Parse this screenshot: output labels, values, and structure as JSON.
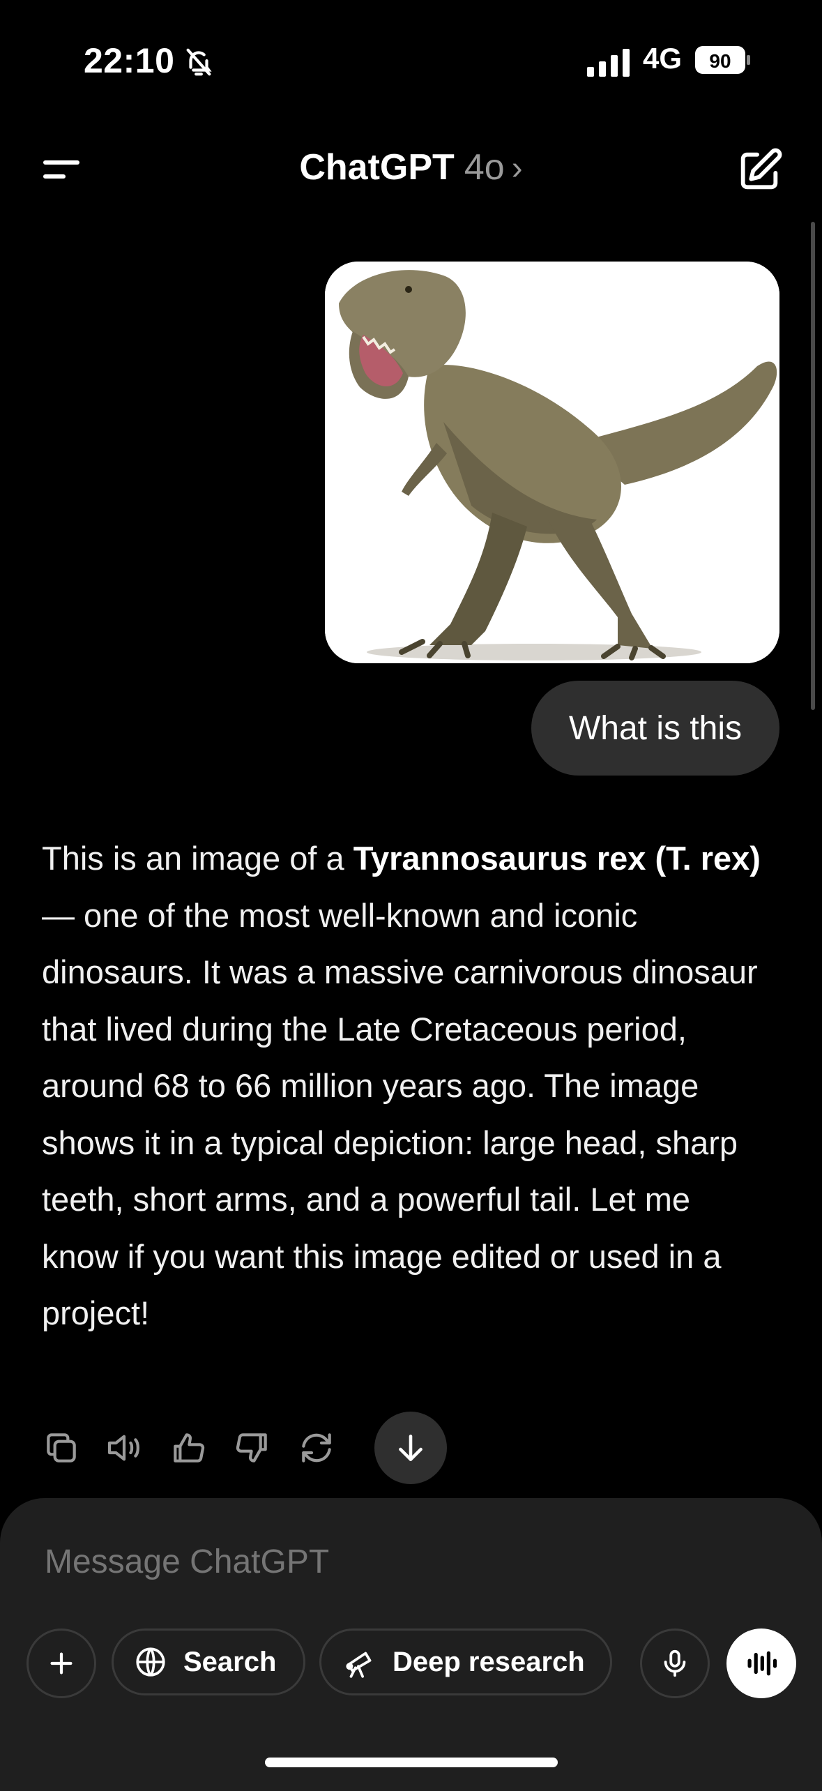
{
  "status_bar": {
    "time": "22:10",
    "network": "4G",
    "battery": "90"
  },
  "header": {
    "title": "ChatGPT",
    "model": "4o",
    "chevron": "›"
  },
  "conversation": {
    "user_image_subject": "Tyrannosaurus rex",
    "user_message": "What is this",
    "assistant_message": {
      "intro": "This is an image of a ",
      "bold": "Tyrannosaurus rex (T. rex)",
      "rest": " — one of the most well-known and iconic dinosaurs. It was a massive carnivorous dinosaur that lived during the Late Cretaceous period, around 68 to 66 million years ago. The image shows it in a typical depiction: large head, sharp teeth, short arms, and a powerful tail. Let me know if you want this image edited or used in a project!"
    },
    "actions": [
      "copy-icon",
      "read-aloud-icon",
      "thumbs-up-icon",
      "thumbs-down-icon",
      "regenerate-icon",
      "scroll-down-icon"
    ]
  },
  "composer": {
    "placeholder": "Message ChatGPT",
    "search_label": "Search",
    "deep_research_label": "Deep research"
  },
  "colors": {
    "background": "#000000",
    "bubble": "#2f2f2f",
    "composer": "#1f1f1f",
    "muted": "#9a9a9a"
  }
}
